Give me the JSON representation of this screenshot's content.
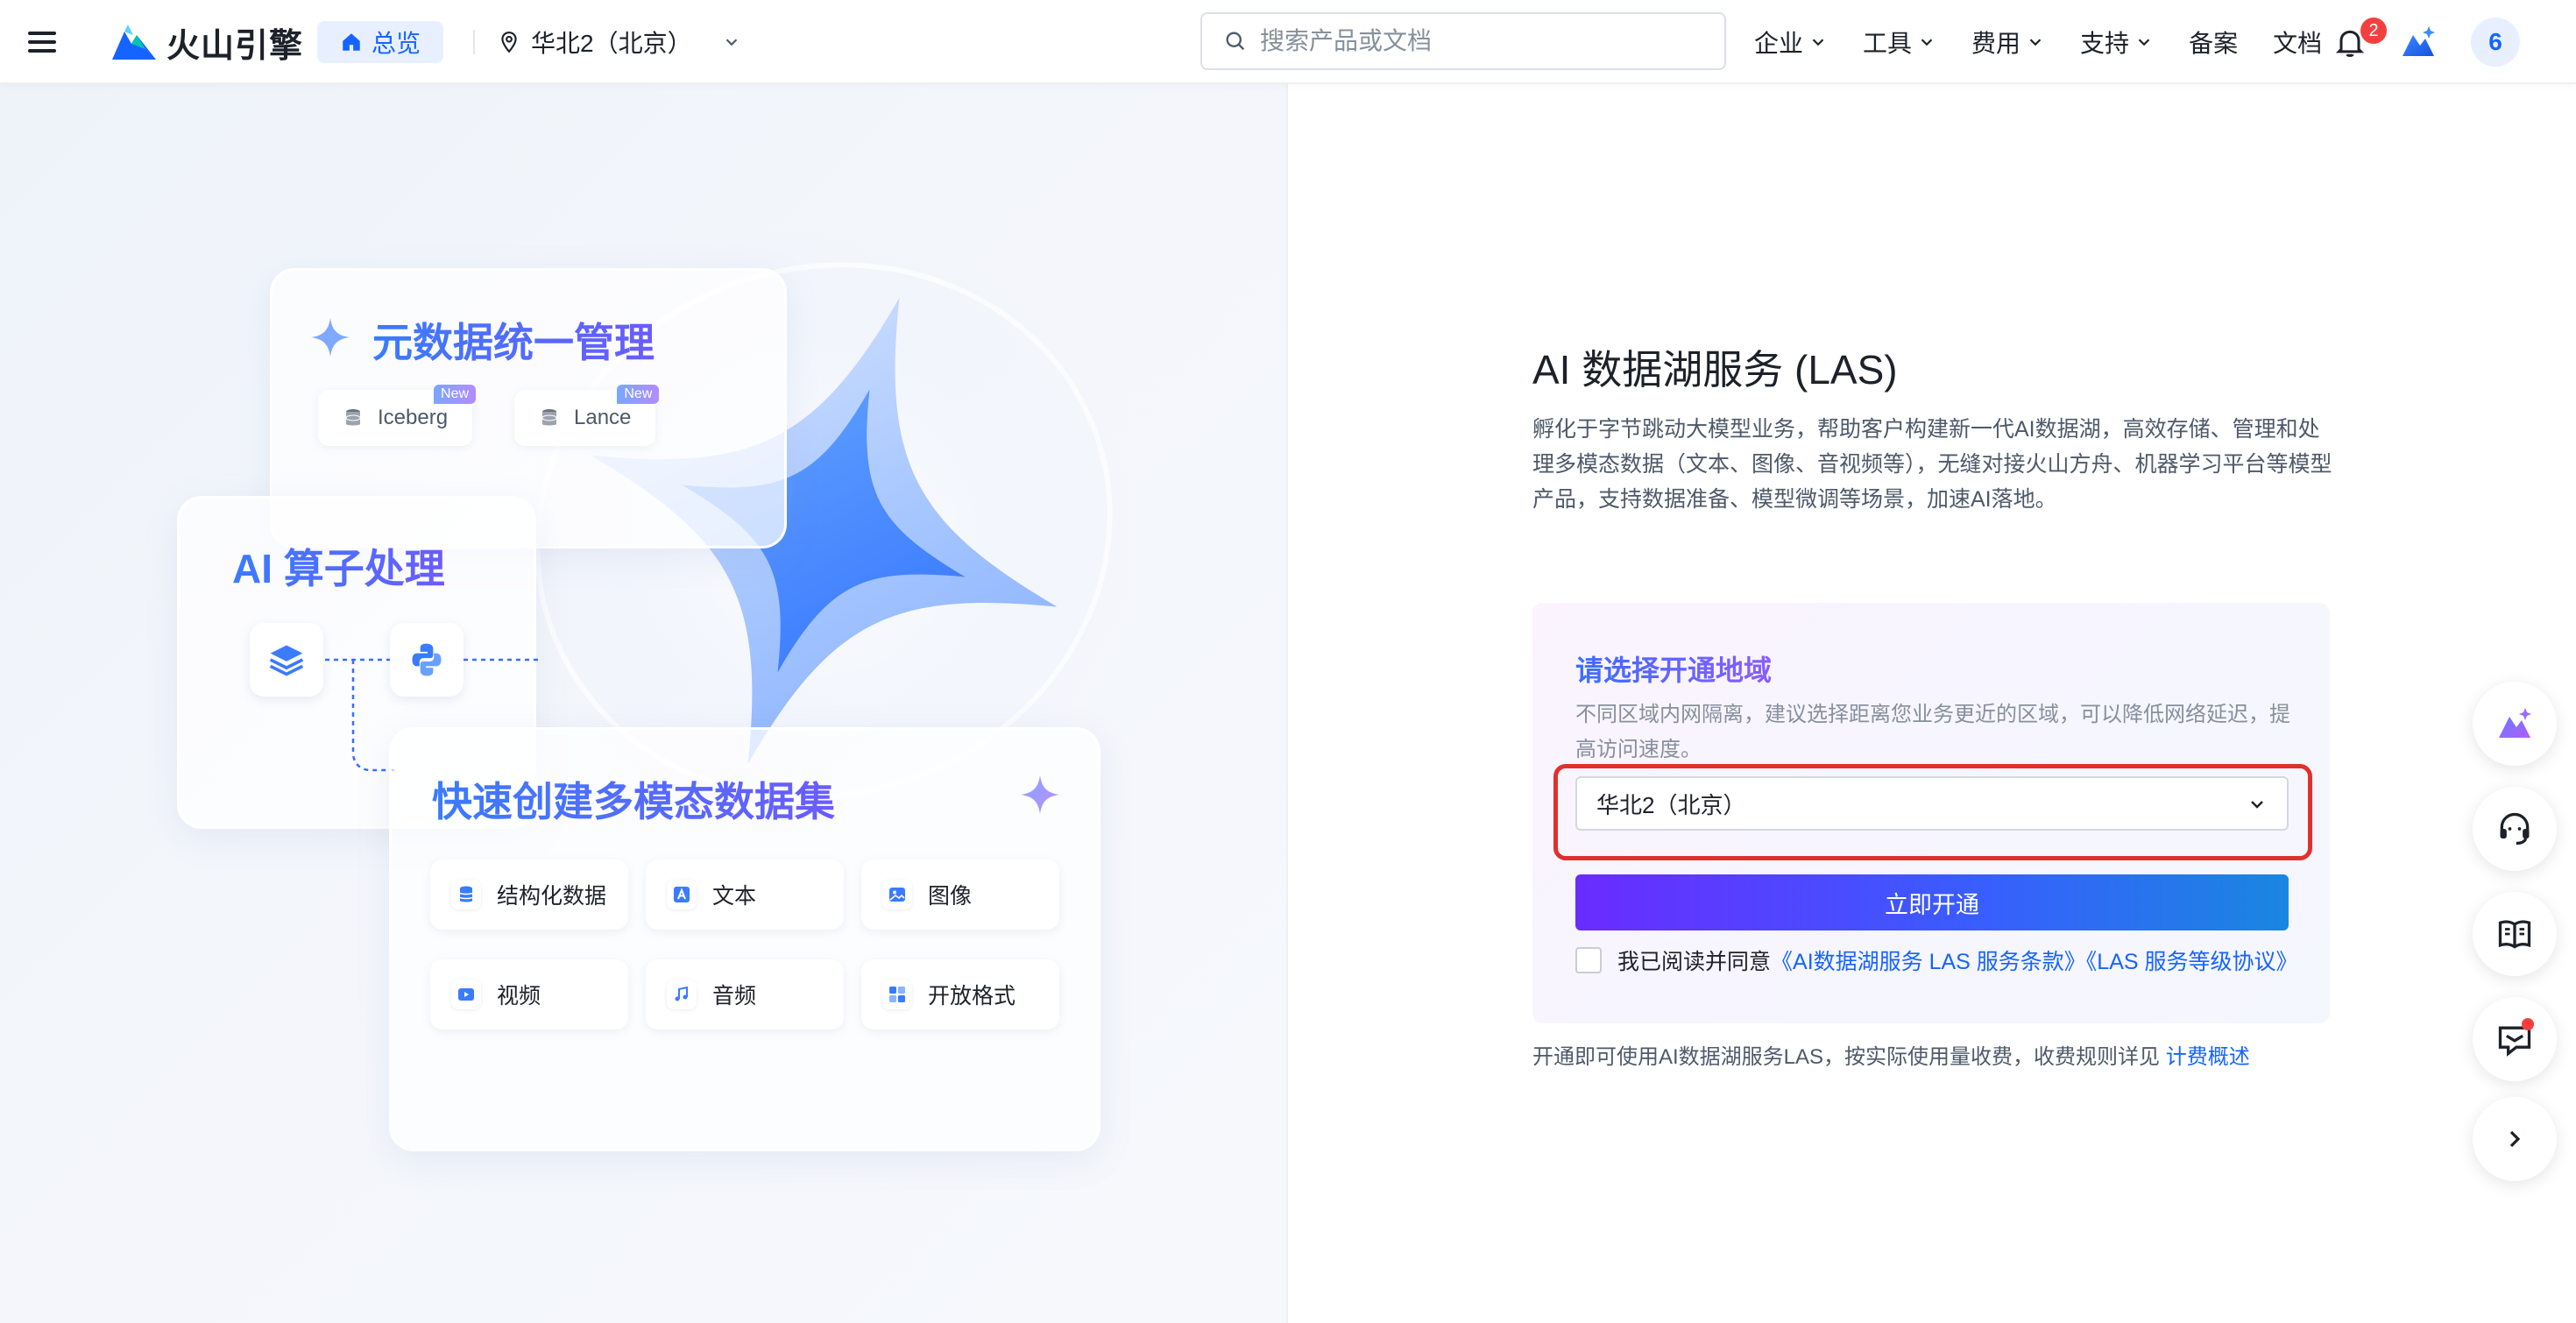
{
  "header": {
    "logo_text": "火山引擎",
    "overview_label": "总览",
    "region": "华北2（北京）",
    "search_placeholder": "搜索产品或文档",
    "nav": [
      {
        "label": "企业"
      },
      {
        "label": "工具"
      },
      {
        "label": "费用"
      },
      {
        "label": "支持"
      },
      {
        "label": "备案"
      },
      {
        "label": "文档"
      }
    ],
    "notification_count": "2",
    "avatar_text": "6"
  },
  "illustration": {
    "meta_title": "元数据统一管理",
    "meta_tags": [
      {
        "label": "Iceberg",
        "badge": "New"
      },
      {
        "label": "Lance",
        "badge": "New"
      }
    ],
    "ai_title": "AI 算子处理",
    "fast_title": "快速创建多模态数据集",
    "modalities": [
      {
        "label": "结构化数据",
        "icon": "database-icon"
      },
      {
        "label": "文本",
        "icon": "text-icon"
      },
      {
        "label": "图像",
        "icon": "image-icon"
      },
      {
        "label": "视频",
        "icon": "video-icon"
      },
      {
        "label": "音频",
        "icon": "audio-icon"
      },
      {
        "label": "开放格式",
        "icon": "grid-icon"
      }
    ]
  },
  "main": {
    "title": "AI 数据湖服务 (LAS)",
    "description": "孵化于字节跳动大模型业务，帮助客户构建新一代AI数据湖，高效存储、管理和处理多模态数据（文本、图像、音视频等），无缝对接火山方舟、机器学习平台等模型产品，支持数据准备、模型微调等场景，加速AI落地。",
    "region_card": {
      "title": "请选择开通地域",
      "description": "不同区域内网隔离，建议选择距离您业务更近的区域，可以降低网络延迟，提高访问速度。",
      "selected_region": "华北2（北京）",
      "activate_button": "立即开通",
      "agree_prefix": "我已阅读并同意",
      "terms_link": "《AI数据湖服务 LAS 服务条款》",
      "sla_link": "《LAS 服务等级协议》"
    },
    "footer_note": "开通即可使用AI数据湖服务LAS，按实际使用量收费，收费规则详见",
    "pricing_link": "计费概述"
  },
  "colors": {
    "accent": "#1664ff",
    "highlight_outline": "#e0302e",
    "button_gradient_start": "#6a2bff",
    "button_gradient_end": "#1a86e0"
  }
}
